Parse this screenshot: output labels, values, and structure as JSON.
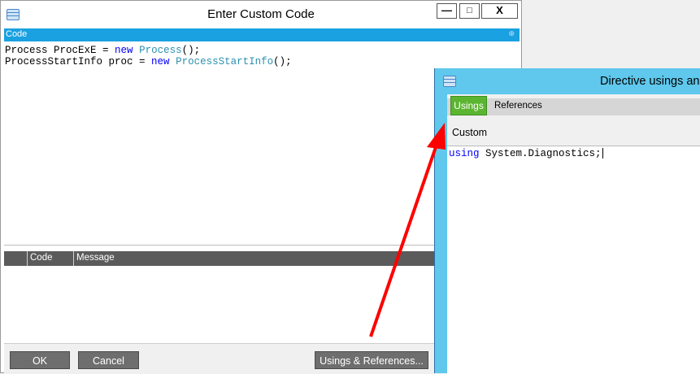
{
  "dialog_main": {
    "title": "Enter Custom Code",
    "buttons": {
      "minimize": "—",
      "maximize": "□",
      "close": "X"
    },
    "code_panel_label": "Code",
    "code_lines": [
      [
        {
          "t": "Process ProcExE = ",
          "c": "plain"
        },
        {
          "t": "new",
          "c": "kw"
        },
        {
          "t": " ",
          "c": "plain"
        },
        {
          "t": "Process",
          "c": "ty"
        },
        {
          "t": "();",
          "c": "plain"
        }
      ],
      [
        {
          "t": "ProcessStartInfo proc = ",
          "c": "plain"
        },
        {
          "t": "new",
          "c": "kw"
        },
        {
          "t": " ",
          "c": "plain"
        },
        {
          "t": "ProcessStartInfo",
          "c": "ty"
        },
        {
          "t": "();",
          "c": "plain"
        }
      ]
    ],
    "grid_columns": [
      "Code",
      "Message"
    ],
    "footer": {
      "ok": "OK",
      "cancel": "Cancel",
      "usings_refs": "Usings & References..."
    }
  },
  "dialog_directives": {
    "title": "Directive usings an",
    "tabs": [
      {
        "label": "Usings",
        "active": true
      },
      {
        "label": "References",
        "active": false
      }
    ],
    "section_label": "Custom",
    "code_line": [
      {
        "t": "using",
        "c": "kw"
      },
      {
        "t": " System.Diagnostics;",
        "c": "plain"
      }
    ]
  },
  "colors": {
    "accent_blue": "#1aa1e1",
    "dialog_title_bg": "#5fc8ec",
    "active_tab_green": "#5cb531",
    "arrow_red": "#ff0000",
    "keyword_blue": "#0000ff",
    "type_teal": "#2b91af"
  }
}
